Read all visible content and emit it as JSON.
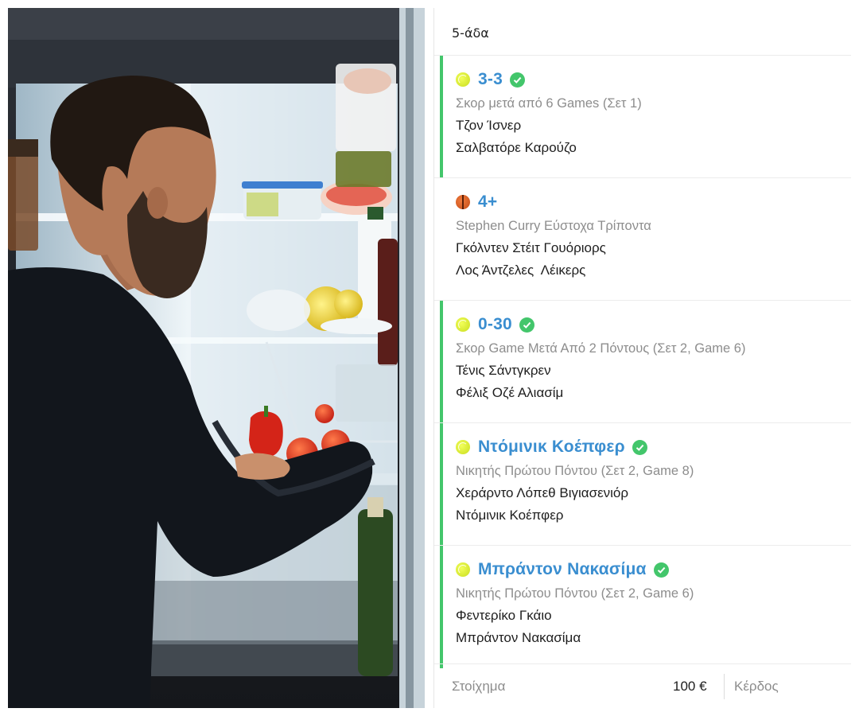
{
  "slip": {
    "header": "5-άδα",
    "bets": [
      {
        "sport_icon": "tennis-ball-icon",
        "selection": "3-3",
        "won": true,
        "market": "Σκορ μετά από 6 Games (Σετ 1)",
        "team1": "Τζον Ίσνερ",
        "team2": "Σαλβατόρε Καρούζο"
      },
      {
        "sport_icon": "basketball-icon",
        "selection": "4+",
        "won": false,
        "market": "Stephen Curry Εύστοχα Τρίποντα",
        "team1": "Γκόλντεν Στέιτ Γουόριορς",
        "team2": "Λος Άντζελες  Λέικερς"
      },
      {
        "sport_icon": "tennis-ball-icon",
        "selection": "0-30",
        "won": true,
        "market": "Σκορ Game Μετά Από 2 Πόντους (Σετ 2, Game 6)",
        "team1": "Τένις Σάντγκρεν",
        "team2": "Φέλιξ Οζέ Αλιασίμ"
      },
      {
        "sport_icon": "tennis-ball-icon",
        "selection": "Ντόμινικ Κοέπφερ",
        "won": true,
        "market": "Νικητής Πρώτου Πόντου (Σετ 2, Game 8)",
        "team1": "Χεράρντο Λόπεθ Βιγιασενιόρ",
        "team2": "Ντόμινικ Κοέπφερ"
      },
      {
        "sport_icon": "tennis-ball-icon",
        "selection": "Μπράντον Νακασίμα",
        "won": true,
        "market": "Νικητής Πρώτου Πόντου (Σετ 2, Game 6)",
        "team1": "Φεντερίκο Γκάιο",
        "team2": "Μπράντον Νακασίμα"
      }
    ],
    "footer": {
      "stake_label": "Στοίχημα",
      "stake_value": "100 €",
      "payout_label": "Κέρδος"
    },
    "colors": {
      "accent_blue": "#3a8ed0",
      "win_green": "#43c66b"
    }
  }
}
